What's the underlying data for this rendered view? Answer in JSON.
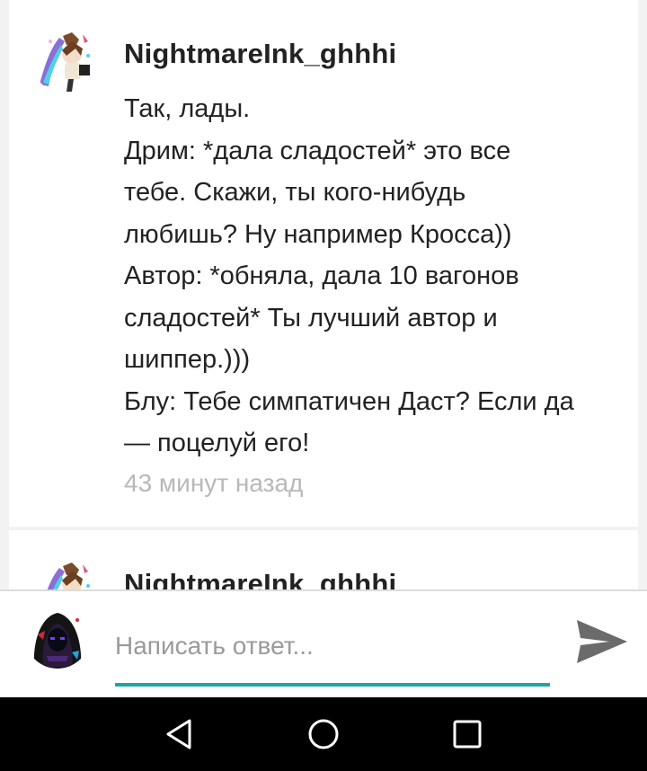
{
  "comments": [
    {
      "username": "NightmareInk_ghhhi",
      "lines": [
        "Так, лады.",
        "Дрим: *дала сладостей* это все",
        "тебе. Скажи, ты кого-нибудь",
        "любишь? Ну например Кросса))",
        "Автор: *обняла, дала 10 вагонов",
        "сладостей* Ты лучший автор и",
        "шиппер.)))",
        "Блу: Тебе симпатичен Даст? Если да",
        "— поцелуй его!"
      ],
      "time": "43 минут назад"
    },
    {
      "username": "NightmareInk_ghhhi"
    }
  ],
  "reply": {
    "placeholder": "Написать ответ...",
    "value": "",
    "accent_color": "#1ea5a5"
  },
  "icons": {
    "send": "send-icon",
    "nav_back": "back-triangle-icon",
    "nav_home": "home-circle-icon",
    "nav_recent": "recent-apps-square-icon"
  }
}
